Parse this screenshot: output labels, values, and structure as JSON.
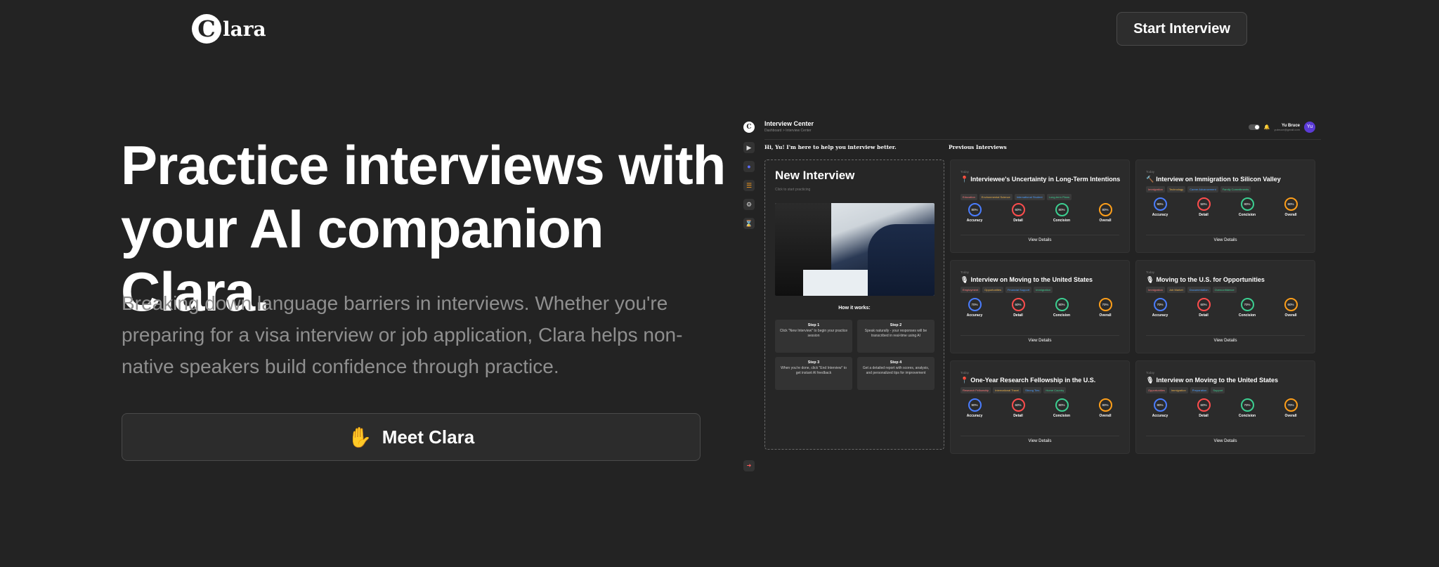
{
  "nav": {
    "logo_mark": "C",
    "logo_text": "lara",
    "start_button": "Start Interview"
  },
  "hero": {
    "title_line1": "Practice interviews with",
    "title_line2": "your AI companion Clara.",
    "subtitle": "Breaking down language barriers in interviews. Whether you're preparing for a visa interview or job application, Clara helps non-native speakers build confidence through practice.",
    "cta_label": "Meet Clara",
    "cta_icon": "waving-hand-icon"
  },
  "app": {
    "title": "Interview Center",
    "breadcrumb": "Dashboard  >  Interview Center",
    "user_name": "Yu Bruce",
    "user_email": "yubruce@gmail.com",
    "avatar": "Yu",
    "greeting": "Hi, Yu! I'm here to help you interview better.",
    "previous_title": "Previous Interviews",
    "new_interview": {
      "title": "New Interview",
      "subtitle": "Click to start practicing",
      "how_title": "How it works:",
      "steps": [
        {
          "title": "Step 1",
          "desc": "Click \"New Interview\" to begin your practice session"
        },
        {
          "title": "Step 2",
          "desc": "Speak naturally - your responses will be transcribed in real-time using AI"
        },
        {
          "title": "Step 3",
          "desc": "When you're done, click \"End Interview\" to get instant AI feedback"
        },
        {
          "title": "Step 4",
          "desc": "Get a detailed report with scores, analysis, and personalized tips for improvement"
        }
      ]
    },
    "metric_labels": [
      "Accuracy",
      "Detail",
      "Concision",
      "Overall"
    ],
    "metric_colors": [
      "#4a7dff",
      "#ff4d4d",
      "#3ccf91",
      "#ff9f1a"
    ],
    "today_label": "Today",
    "view_details": "View Details",
    "cards": [
      {
        "title": "Interviewee's Uncertainty in Long-Term Intentions",
        "icon": "pin-icon",
        "tags": [
          "Education",
          "Environmental Science",
          "International Student",
          "Long-term Plans"
        ],
        "scores": [
          "80%",
          "60%",
          "80%",
          "80%"
        ]
      },
      {
        "title": "Interview on Immigration to Silicon Valley",
        "icon": "hammer-icon",
        "tags": [
          "Immigration",
          "Technology",
          "Career Advancement",
          "Family Commitments"
        ],
        "scores": [
          "90%",
          "50%",
          "80%",
          "80%"
        ]
      },
      {
        "title": "Interview on Moving to the United States",
        "icon": "microphone-icon",
        "tags": [
          "Employment",
          "Opportunities",
          "Financial Support",
          "Immigration"
        ],
        "scores": [
          "70%",
          "60%",
          "80%",
          "70%"
        ]
      },
      {
        "title": "Moving to the U.S. for Opportunities",
        "icon": "microphone-icon",
        "tags": [
          "Immigration",
          "Job Market",
          "Documentation",
          "Overconfidence"
        ],
        "scores": [
          "70%",
          "60%",
          "70%",
          "60%"
        ]
      },
      {
        "title": "One-Year Research Fellowship in the U.S.",
        "icon": "pin-icon",
        "tags": [
          "Research Fellowship",
          "International Travel",
          "Strong Ties",
          "Home Country"
        ],
        "scores": [
          "90%",
          "60%",
          "80%",
          "80%"
        ]
      },
      {
        "title": "Interview on Moving to the United States",
        "icon": "microphone-icon",
        "tags": [
          "Opportunities",
          "Immigration",
          "Preparation",
          "Support"
        ],
        "scores": [
          "80%",
          "60%",
          "70%",
          "70%"
        ]
      }
    ],
    "tag_colors": [
      "#ff7a7a",
      "#f0b44a",
      "#4a9dff",
      "#3ccf91",
      "#c98cff"
    ]
  }
}
